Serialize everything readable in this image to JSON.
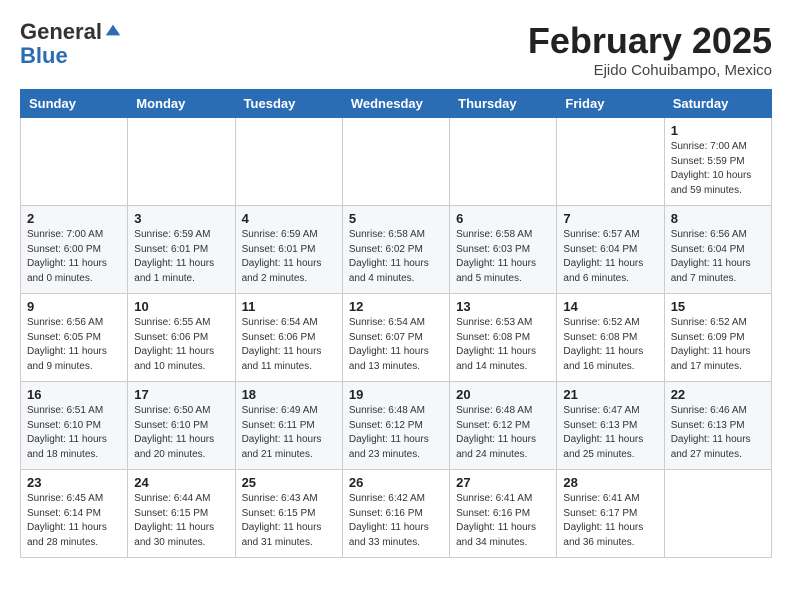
{
  "logo": {
    "line1": "General",
    "line2": "Blue"
  },
  "title": "February 2025",
  "location": "Ejido Cohuibampo, Mexico",
  "days_of_week": [
    "Sunday",
    "Monday",
    "Tuesday",
    "Wednesday",
    "Thursday",
    "Friday",
    "Saturday"
  ],
  "weeks": [
    [
      {
        "day": "",
        "info": ""
      },
      {
        "day": "",
        "info": ""
      },
      {
        "day": "",
        "info": ""
      },
      {
        "day": "",
        "info": ""
      },
      {
        "day": "",
        "info": ""
      },
      {
        "day": "",
        "info": ""
      },
      {
        "day": "1",
        "info": "Sunrise: 7:00 AM\nSunset: 5:59 PM\nDaylight: 10 hours\nand 59 minutes."
      }
    ],
    [
      {
        "day": "2",
        "info": "Sunrise: 7:00 AM\nSunset: 6:00 PM\nDaylight: 11 hours\nand 0 minutes."
      },
      {
        "day": "3",
        "info": "Sunrise: 6:59 AM\nSunset: 6:01 PM\nDaylight: 11 hours\nand 1 minute."
      },
      {
        "day": "4",
        "info": "Sunrise: 6:59 AM\nSunset: 6:01 PM\nDaylight: 11 hours\nand 2 minutes."
      },
      {
        "day": "5",
        "info": "Sunrise: 6:58 AM\nSunset: 6:02 PM\nDaylight: 11 hours\nand 4 minutes."
      },
      {
        "day": "6",
        "info": "Sunrise: 6:58 AM\nSunset: 6:03 PM\nDaylight: 11 hours\nand 5 minutes."
      },
      {
        "day": "7",
        "info": "Sunrise: 6:57 AM\nSunset: 6:04 PM\nDaylight: 11 hours\nand 6 minutes."
      },
      {
        "day": "8",
        "info": "Sunrise: 6:56 AM\nSunset: 6:04 PM\nDaylight: 11 hours\nand 7 minutes."
      }
    ],
    [
      {
        "day": "9",
        "info": "Sunrise: 6:56 AM\nSunset: 6:05 PM\nDaylight: 11 hours\nand 9 minutes."
      },
      {
        "day": "10",
        "info": "Sunrise: 6:55 AM\nSunset: 6:06 PM\nDaylight: 11 hours\nand 10 minutes."
      },
      {
        "day": "11",
        "info": "Sunrise: 6:54 AM\nSunset: 6:06 PM\nDaylight: 11 hours\nand 11 minutes."
      },
      {
        "day": "12",
        "info": "Sunrise: 6:54 AM\nSunset: 6:07 PM\nDaylight: 11 hours\nand 13 minutes."
      },
      {
        "day": "13",
        "info": "Sunrise: 6:53 AM\nSunset: 6:08 PM\nDaylight: 11 hours\nand 14 minutes."
      },
      {
        "day": "14",
        "info": "Sunrise: 6:52 AM\nSunset: 6:08 PM\nDaylight: 11 hours\nand 16 minutes."
      },
      {
        "day": "15",
        "info": "Sunrise: 6:52 AM\nSunset: 6:09 PM\nDaylight: 11 hours\nand 17 minutes."
      }
    ],
    [
      {
        "day": "16",
        "info": "Sunrise: 6:51 AM\nSunset: 6:10 PM\nDaylight: 11 hours\nand 18 minutes."
      },
      {
        "day": "17",
        "info": "Sunrise: 6:50 AM\nSunset: 6:10 PM\nDaylight: 11 hours\nand 20 minutes."
      },
      {
        "day": "18",
        "info": "Sunrise: 6:49 AM\nSunset: 6:11 PM\nDaylight: 11 hours\nand 21 minutes."
      },
      {
        "day": "19",
        "info": "Sunrise: 6:48 AM\nSunset: 6:12 PM\nDaylight: 11 hours\nand 23 minutes."
      },
      {
        "day": "20",
        "info": "Sunrise: 6:48 AM\nSunset: 6:12 PM\nDaylight: 11 hours\nand 24 minutes."
      },
      {
        "day": "21",
        "info": "Sunrise: 6:47 AM\nSunset: 6:13 PM\nDaylight: 11 hours\nand 25 minutes."
      },
      {
        "day": "22",
        "info": "Sunrise: 6:46 AM\nSunset: 6:13 PM\nDaylight: 11 hours\nand 27 minutes."
      }
    ],
    [
      {
        "day": "23",
        "info": "Sunrise: 6:45 AM\nSunset: 6:14 PM\nDaylight: 11 hours\nand 28 minutes."
      },
      {
        "day": "24",
        "info": "Sunrise: 6:44 AM\nSunset: 6:15 PM\nDaylight: 11 hours\nand 30 minutes."
      },
      {
        "day": "25",
        "info": "Sunrise: 6:43 AM\nSunset: 6:15 PM\nDaylight: 11 hours\nand 31 minutes."
      },
      {
        "day": "26",
        "info": "Sunrise: 6:42 AM\nSunset: 6:16 PM\nDaylight: 11 hours\nand 33 minutes."
      },
      {
        "day": "27",
        "info": "Sunrise: 6:41 AM\nSunset: 6:16 PM\nDaylight: 11 hours\nand 34 minutes."
      },
      {
        "day": "28",
        "info": "Sunrise: 6:41 AM\nSunset: 6:17 PM\nDaylight: 11 hours\nand 36 minutes."
      },
      {
        "day": "",
        "info": ""
      }
    ]
  ]
}
